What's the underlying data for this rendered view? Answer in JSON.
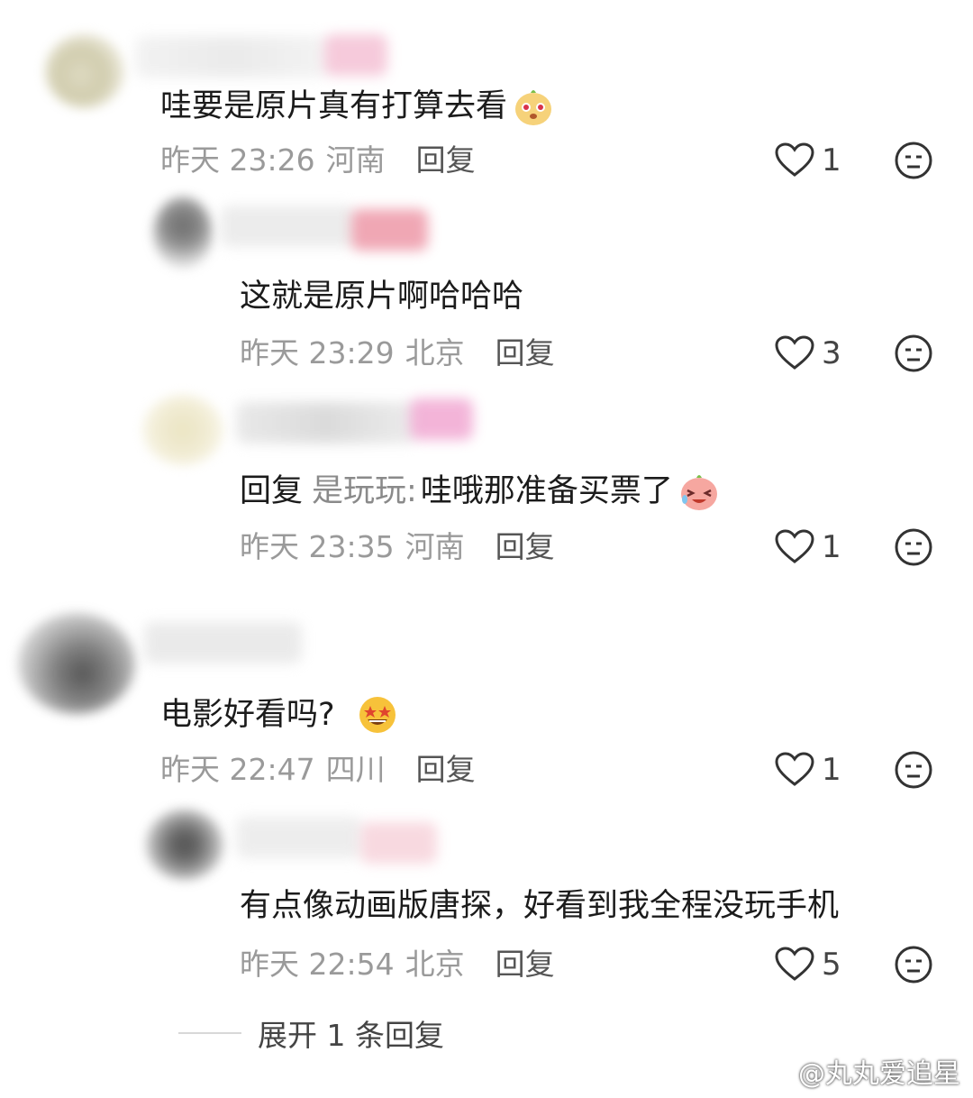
{
  "comments": [
    {
      "text": "哇要是原片真有打算去看",
      "time": "昨天 23:26",
      "region": "河南",
      "reply_label": "回复",
      "likes": "1",
      "emoji": "dumpling-face-emoji"
    },
    {
      "text": "这就是原片啊哈哈哈",
      "time": "昨天 23:29",
      "region": "北京",
      "reply_label": "回复",
      "likes": "3"
    },
    {
      "reply_prefix": "回复",
      "reply_to": "是玩玩:",
      "text": "哇哦那准备买票了",
      "time": "昨天 23:35",
      "region": "河南",
      "reply_label": "回复",
      "likes": "1",
      "emoji": "laughing-crying-peach-emoji"
    },
    {
      "text": "电影好看吗?",
      "time": "昨天 22:47",
      "region": "四川",
      "reply_label": "回复",
      "likes": "1",
      "emoji": "star-struck-emoji"
    },
    {
      "text": "有点像动画版唐探，好看到我全程没玩手机",
      "time": "昨天 22:54",
      "region": "北京",
      "reply_label": "回复",
      "likes": "5"
    }
  ],
  "expand_label": "展开 1 条回复",
  "watermark": "@丸丸爱追星",
  "colors": {
    "heart_outline": "#333333",
    "meta_gray": "#9a9a9a"
  }
}
